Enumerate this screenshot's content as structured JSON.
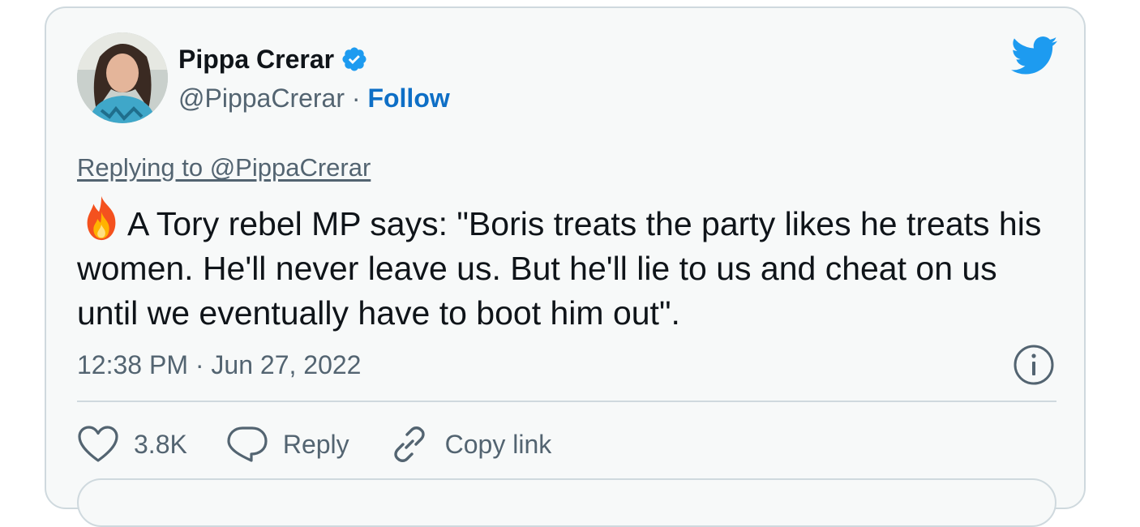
{
  "author": {
    "name": "Pippa Crerar",
    "handle": "@PippaCrerar",
    "separator": "·",
    "follow_label": "Follow"
  },
  "tweet": {
    "replying_to": "Replying to @PippaCrerar",
    "emoji": "fire-emoji",
    "text": "A Tory rebel MP says: \"Boris treats the party likes he treats his women. He'll never leave us. But he'll lie to us and cheat on us until we eventually have to boot him out\".",
    "timestamp": "12:38 PM · Jun 27, 2022"
  },
  "actions": {
    "likes_count": "3.8K",
    "reply_label": "Reply",
    "copy_link_label": "Copy link"
  },
  "icons": {
    "brand": "twitter-bird-icon",
    "verified": "verified-badge-icon",
    "info": "info-icon",
    "like": "heart-icon",
    "reply": "speech-bubble-icon",
    "copy": "link-icon"
  },
  "colors": {
    "accent": "#1d9bf0",
    "follow": "#0e6fc6",
    "muted_text": "#536471",
    "card_background": "#f7f9f9",
    "border": "#cfd9de"
  }
}
